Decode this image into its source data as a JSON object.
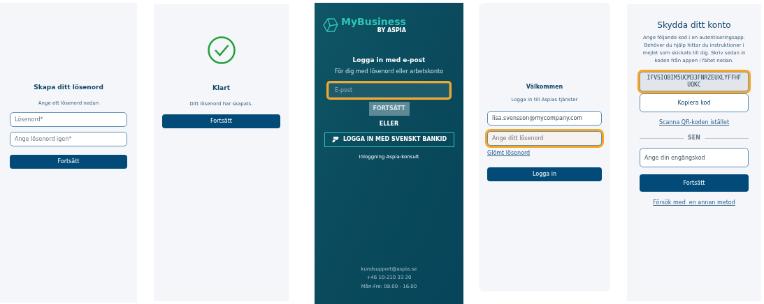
{
  "create_password": {
    "title": "Skapa ditt lösenord",
    "subtitle": "Ange ett lösenord nedan",
    "fields": [
      {
        "placeholder": "Lösenord*",
        "highlighted": false
      },
      {
        "placeholder": "Ange lösenord igen*",
        "highlighted": false
      }
    ],
    "button": "Fortsätt"
  },
  "done": {
    "title": "Klart",
    "message": "Ditt lösenord har skapats.",
    "button": "Fortsätt"
  },
  "email_login": {
    "logo": "MyBusiness",
    "logo_sub": "BY ASPIA",
    "title": "Logga in med e-post",
    "subtitle": "För dig med lösenord eller arbetskonto",
    "field": {
      "placeholder": "E-post",
      "highlighted": true
    },
    "button": "FORTSÄTT",
    "divider": "ELLER",
    "bankid_button": "LOGGA IN MED SVENSKT BANKID",
    "consultant_link": "Inloggning Aspia-konsult",
    "footer": [
      "kundsupport@aspia.se",
      "+46 10-210 33 20",
      "Mån-Fre: 08.00 - 16.00"
    ]
  },
  "welcome": {
    "title": "Välkommen",
    "subtitle": "Logga in till Aspias tjänster",
    "fields": [
      {
        "value": "lisa.svensson@mycompany.com",
        "highlighted": false
      },
      {
        "placeholder": "Ange ditt lösenord",
        "highlighted": true
      }
    ],
    "forgot_link": "Glömt lösenord",
    "button": "Logga in"
  },
  "protect_account": {
    "title": "Skydda ditt konto",
    "instructions": "Ange följande kod i en autentiseringsapp. Behöver du hjälp hittar du instruktioner i mejlet som skickats till dig. Skriv sedan in koden från appen i fältet nedan.",
    "code": "IFVSIOBIM5UCM33FNRZEUXLYFFHF UQKC",
    "code_highlighted": true,
    "copy_button": "Kopiera kod",
    "qr_link": "Scanna QR-koden istället",
    "divider": "SEN",
    "field": {
      "placeholder": "Ange din engångskod",
      "highlighted": false
    },
    "button": "Fortsätt",
    "other_method_link": "Försök med  en annan metod"
  }
}
